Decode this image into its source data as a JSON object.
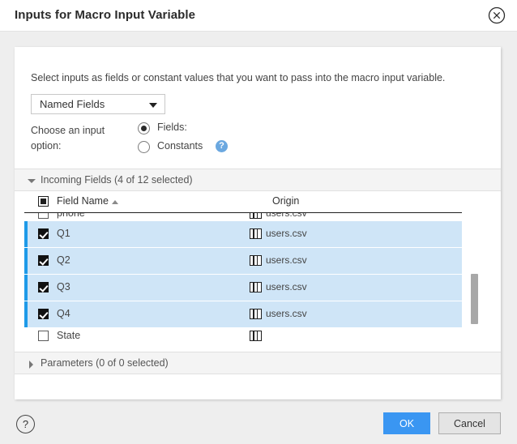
{
  "dialog": {
    "title": "Inputs for Macro Input Variable",
    "close_icon": "close-circle-icon"
  },
  "body": {
    "intro": "Select inputs as fields or constant values that you want to pass into the macro input variable.",
    "input_type_select": {
      "value": "Named Fields",
      "arrow_icon": "chevron-down-icon"
    },
    "choose_label": "Choose an input option:",
    "radios": [
      {
        "label": "Fields:",
        "selected": true
      },
      {
        "label": "Constants",
        "selected": false,
        "help_icon": "question-circle-icon"
      }
    ]
  },
  "incoming_fields": {
    "header": "Incoming Fields (4 of 12 selected)",
    "caret_icon": "caret-down-icon",
    "expanded": true,
    "columns": [
      "Field Name",
      "Origin"
    ],
    "sort_icon": "sort-ascending-icon",
    "select_all_state": "indeterminate",
    "rows": [
      {
        "name": "phone",
        "origin": "users.csv",
        "selected": false,
        "clipped": "top"
      },
      {
        "name": "Q1",
        "origin": "users.csv",
        "selected": true
      },
      {
        "name": "Q2",
        "origin": "users.csv",
        "selected": true
      },
      {
        "name": "Q3",
        "origin": "users.csv",
        "selected": true
      },
      {
        "name": "Q4",
        "origin": "users.csv",
        "selected": true
      },
      {
        "name": "State",
        "origin": "",
        "selected": false,
        "clipped": "bottom"
      }
    ],
    "origin_icon": "table-grid-icon"
  },
  "parameters": {
    "header": "Parameters (0 of 0 selected)",
    "caret_icon": "caret-right-icon",
    "expanded": false
  },
  "footer": {
    "help_label": "?",
    "ok_label": "OK",
    "cancel_label": "Cancel"
  },
  "colors": {
    "accent_blue": "#1e9ae8",
    "row_selected_bg": "#cfe5f7",
    "ok_button_bg": "#3a96f2",
    "panel_bg": "#ffffff",
    "window_bg": "#eeeeee",
    "section_header_bg": "#f4f4f4"
  }
}
